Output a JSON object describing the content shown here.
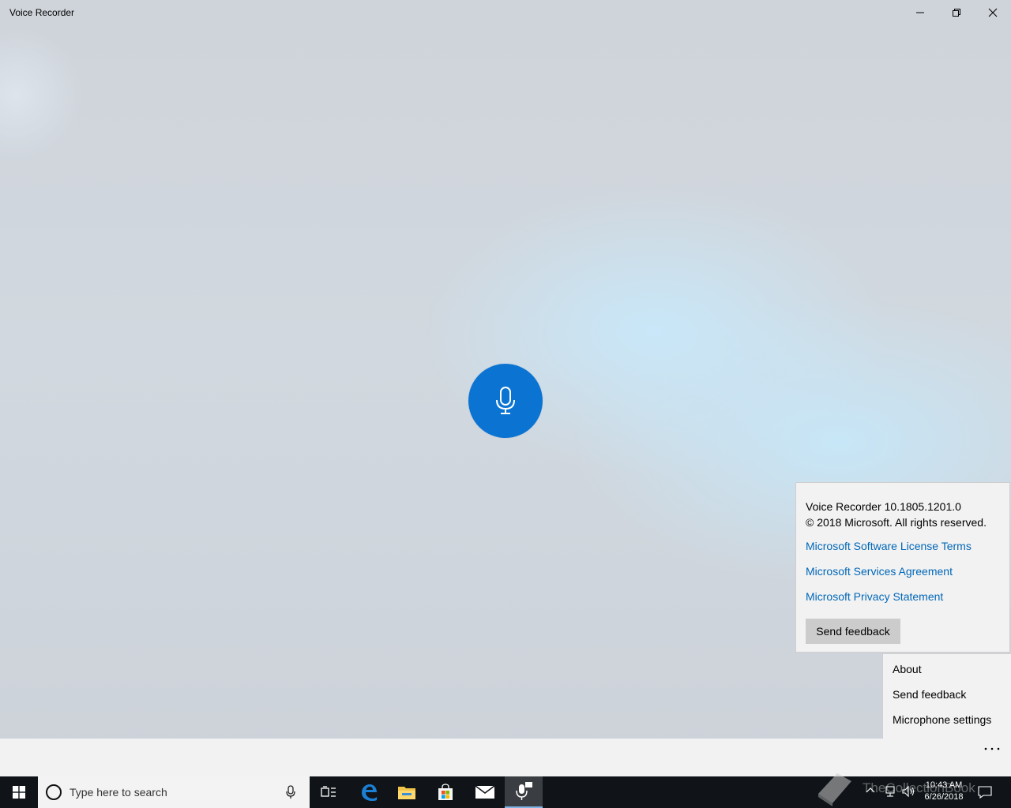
{
  "window": {
    "title": "Voice Recorder"
  },
  "about": {
    "version": "Voice Recorder 10.1805.1201.0",
    "copyright": "© 2018 Microsoft. All rights reserved.",
    "links": [
      "Microsoft Software License Terms",
      "Microsoft Services Agreement",
      "Microsoft Privacy Statement"
    ],
    "feedback_button": "Send feedback"
  },
  "menu": {
    "items": [
      "About",
      "Send feedback",
      "Microphone settings"
    ]
  },
  "command_bar": {
    "more_label": "..."
  },
  "taskbar": {
    "search_placeholder": "Type here to search",
    "time": "10:43 AM",
    "date": "6/26/2018",
    "watermark": "TheCollectionBook"
  },
  "colors": {
    "accent": "#0b74d3",
    "link": "#0067b8",
    "taskbar": "#101418"
  },
  "icons": {
    "record": "microphone-icon",
    "minimize": "minimize-icon",
    "maximize": "restore-icon",
    "close": "close-icon"
  }
}
